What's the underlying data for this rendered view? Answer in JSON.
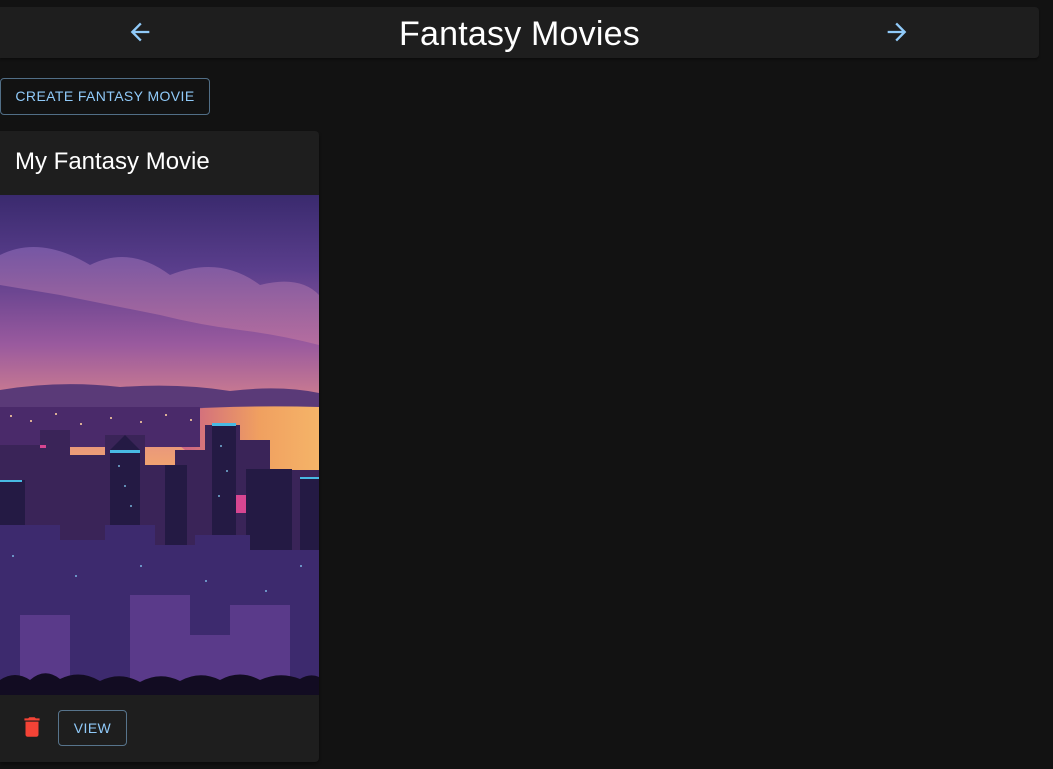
{
  "header": {
    "title": "Fantasy Movies",
    "back_icon": "arrow-left-icon",
    "forward_icon": "arrow-right-icon"
  },
  "toolbar": {
    "create_label": "CREATE FANTASY MOVIE"
  },
  "movies": [
    {
      "title": "My Fantasy Movie",
      "image": "city-skyline-at-dusk",
      "delete_icon": "trash-icon",
      "view_label": "VIEW"
    }
  ],
  "colors": {
    "background": "#121212",
    "surface": "#1e1e1e",
    "accent": "#90caf9",
    "danger": "#f44336"
  }
}
